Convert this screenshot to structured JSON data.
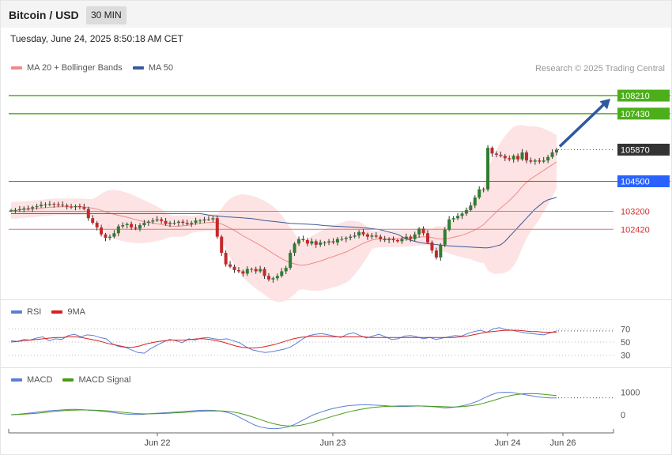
{
  "header": {
    "pair": "Bitcoin / USD",
    "timeframe": "30 MIN"
  },
  "datetime": "Tuesday, June 24, 2025 8:50:18 AM CET",
  "credit": "Research © 2025 Trading Central",
  "legends": {
    "price": [
      {
        "label": "MA 20 + Bollinger Bands",
        "color": "#f08a8a"
      },
      {
        "label": "MA 50",
        "color": "#3a5a9a"
      }
    ],
    "rsi": [
      {
        "label": "RSI",
        "color": "#5a7fd4"
      },
      {
        "label": "9MA",
        "color": "#d62020"
      }
    ],
    "macd": [
      {
        "label": "MACD",
        "color": "#5a7fd4"
      },
      {
        "label": "MACD Signal",
        "color": "#4a9a1a"
      }
    ]
  },
  "colors": {
    "up": "#2e7d32",
    "down": "#c62828",
    "resistance": "#4caf1a",
    "pivot": "#2962ff",
    "support": "#e57373",
    "last": "#333333",
    "arrow": "#2e5a9e"
  },
  "chart_data": [
    {
      "type": "candlestick",
      "title": "Bitcoin / USD",
      "x_ticks": [
        "Jun 22",
        "Jun 23",
        "Jun 24",
        "Jun 26"
      ],
      "levels": [
        {
          "value": 108210,
          "label": "108210",
          "kind": "resistance"
        },
        {
          "value": 107430,
          "label": "107430",
          "kind": "resistance"
        },
        {
          "value": 105870,
          "label": "105870",
          "kind": "last"
        },
        {
          "value": 104500,
          "label": "104500",
          "kind": "pivot"
        },
        {
          "value": 103200,
          "label": "103200",
          "kind": "support"
        },
        {
          "value": 102420,
          "label": "102420",
          "kind": "support"
        }
      ],
      "closes": [
        103240,
        103250,
        103290,
        103330,
        103320,
        103380,
        103420,
        103480,
        103500,
        103520,
        103500,
        103480,
        103450,
        103400,
        103380,
        103420,
        103380,
        103300,
        102900,
        102700,
        102500,
        102200,
        102050,
        102100,
        102250,
        102550,
        102600,
        102650,
        102500,
        102450,
        102600,
        102700,
        102750,
        102800,
        102850,
        102780,
        102650,
        102700,
        102700,
        102750,
        102700,
        102650,
        102700,
        102800,
        102800,
        102850,
        102850,
        102900,
        102100,
        101400,
        100900,
        100800,
        100650,
        100600,
        100500,
        100700,
        100700,
        100600,
        100700,
        100400,
        100250,
        100300,
        100400,
        100600,
        100750,
        101400,
        101800,
        102000,
        101950,
        101800,
        101900,
        101750,
        101850,
        101850,
        101900,
        101850,
        102000,
        102000,
        102050,
        102100,
        102150,
        102300,
        102200,
        102100,
        102150,
        102100,
        102000,
        101950,
        102000,
        101950,
        101900,
        102000,
        102100,
        102000,
        102200,
        102450,
        102250,
        101850,
        101500,
        101200,
        101750,
        102400,
        102850,
        102900,
        103000,
        103100,
        103250,
        103450,
        103800,
        104150,
        104150,
        105950,
        105700,
        105650,
        105600,
        105500,
        105450,
        105600,
        105450,
        105750,
        105400,
        105350,
        105400,
        105350,
        105400,
        105550,
        105750,
        105870
      ],
      "ma50": [
        103100,
        103070,
        103040,
        103010,
        102990,
        102980,
        102960,
        102950,
        102940,
        102930,
        102910,
        102900,
        102880,
        102860,
        102830,
        102800,
        102780,
        102760,
        102740,
        102720,
        102700,
        102680,
        102670,
        102660,
        102650,
        102640,
        102630,
        102620,
        102600,
        102580,
        102570,
        102560,
        102550,
        102540,
        102530,
        102520,
        102510,
        102500,
        102480,
        102470,
        102450,
        102430,
        102400,
        102350,
        102300,
        102250,
        102200,
        102100,
        102000,
        101950,
        101900,
        101850,
        101820,
        101800,
        101780,
        101760,
        101740,
        101720,
        101700,
        101690,
        101680,
        101670,
        101660,
        101650,
        101640,
        101630,
        101620,
        101620,
        101650,
        101700,
        101750,
        101900,
        102100,
        102300,
        102500,
        102700,
        102900,
        103100,
        103300,
        103450,
        103600,
        103700,
        103750,
        103800
      ],
      "y_range": [
        99350,
        108930
      ]
    },
    {
      "type": "line",
      "title": "RSI",
      "y_ticks": [
        70,
        50,
        30
      ],
      "series": [
        {
          "name": "RSI",
          "values": [
            52,
            51,
            54,
            53,
            56,
            58,
            52,
            55,
            54,
            60,
            62,
            58,
            61,
            60,
            57,
            55,
            47,
            43,
            42,
            38,
            34,
            33,
            40,
            45,
            50,
            54,
            52,
            49,
            55,
            53,
            56,
            57,
            55,
            54,
            55,
            52,
            49,
            43,
            38,
            36,
            34,
            35,
            37,
            39,
            42,
            48,
            55,
            60,
            62,
            63,
            61,
            59,
            57,
            62,
            64,
            60,
            56,
            59,
            62,
            58,
            54,
            55,
            59,
            60,
            58,
            55,
            57,
            54,
            56,
            58,
            60,
            59,
            63,
            66,
            68,
            65,
            70,
            72,
            69,
            68,
            66,
            64,
            63,
            62,
            61,
            64,
            67
          ]
        },
        {
          "name": "9MA",
          "values": [
            50,
            51,
            52,
            53,
            54,
            55,
            56,
            57,
            57,
            58,
            58,
            57,
            55,
            53,
            51,
            48,
            46,
            44,
            42,
            42,
            44,
            47,
            49,
            51,
            52,
            53,
            53,
            53,
            54,
            55,
            55,
            54,
            52,
            50,
            47,
            44,
            42,
            41,
            41,
            42,
            44,
            46,
            49,
            52,
            55,
            57,
            58,
            59,
            59,
            59,
            58,
            58,
            58,
            58,
            58,
            58,
            57,
            57,
            57,
            57,
            57,
            57,
            57,
            57,
            57,
            57,
            57,
            57,
            57,
            57,
            58,
            59,
            61,
            63,
            65,
            66,
            67,
            68,
            68,
            68,
            67,
            66,
            66,
            65,
            65,
            65
          ]
        }
      ]
    },
    {
      "type": "line",
      "title": "MACD",
      "y_ticks": [
        1000,
        0
      ],
      "series": [
        {
          "name": "MACD",
          "values": [
            0,
            20,
            50,
            80,
            120,
            150,
            180,
            200,
            220,
            240,
            240,
            220,
            200,
            180,
            150,
            120,
            80,
            40,
            20,
            10,
            20,
            40,
            60,
            80,
            100,
            120,
            140,
            160,
            180,
            200,
            200,
            190,
            160,
            100,
            0,
            -150,
            -300,
            -450,
            -550,
            -600,
            -620,
            -600,
            -550,
            -450,
            -300,
            -150,
            0,
            100,
            200,
            280,
            340,
            390,
            420,
            440,
            450,
            430,
            420,
            400,
            380,
            370,
            370,
            380,
            390,
            380,
            360,
            340,
            300,
            320,
            360,
            420,
            500,
            600,
            750,
            880,
            980,
            1000,
            990,
            950,
            900,
            850,
            800,
            770,
            750,
            750
          ]
        },
        {
          "name": "MACD Signal",
          "values": [
            0,
            10,
            25,
            45,
            70,
            100,
            130,
            160,
            180,
            200,
            210,
            215,
            210,
            200,
            185,
            165,
            140,
            110,
            80,
            55,
            40,
            40,
            45,
            55,
            70,
            85,
            100,
            120,
            140,
            160,
            170,
            175,
            170,
            150,
            110,
            50,
            -30,
            -120,
            -220,
            -320,
            -400,
            -460,
            -500,
            -500,
            -470,
            -410,
            -330,
            -240,
            -150,
            -60,
            20,
            100,
            170,
            230,
            280,
            320,
            350,
            370,
            380,
            390,
            390,
            390,
            390,
            385,
            375,
            365,
            355,
            345,
            350,
            370,
            400,
            450,
            520,
            600,
            690,
            780,
            850,
            900,
            930,
            940,
            930,
            910,
            880,
            850
          ]
        }
      ]
    }
  ]
}
